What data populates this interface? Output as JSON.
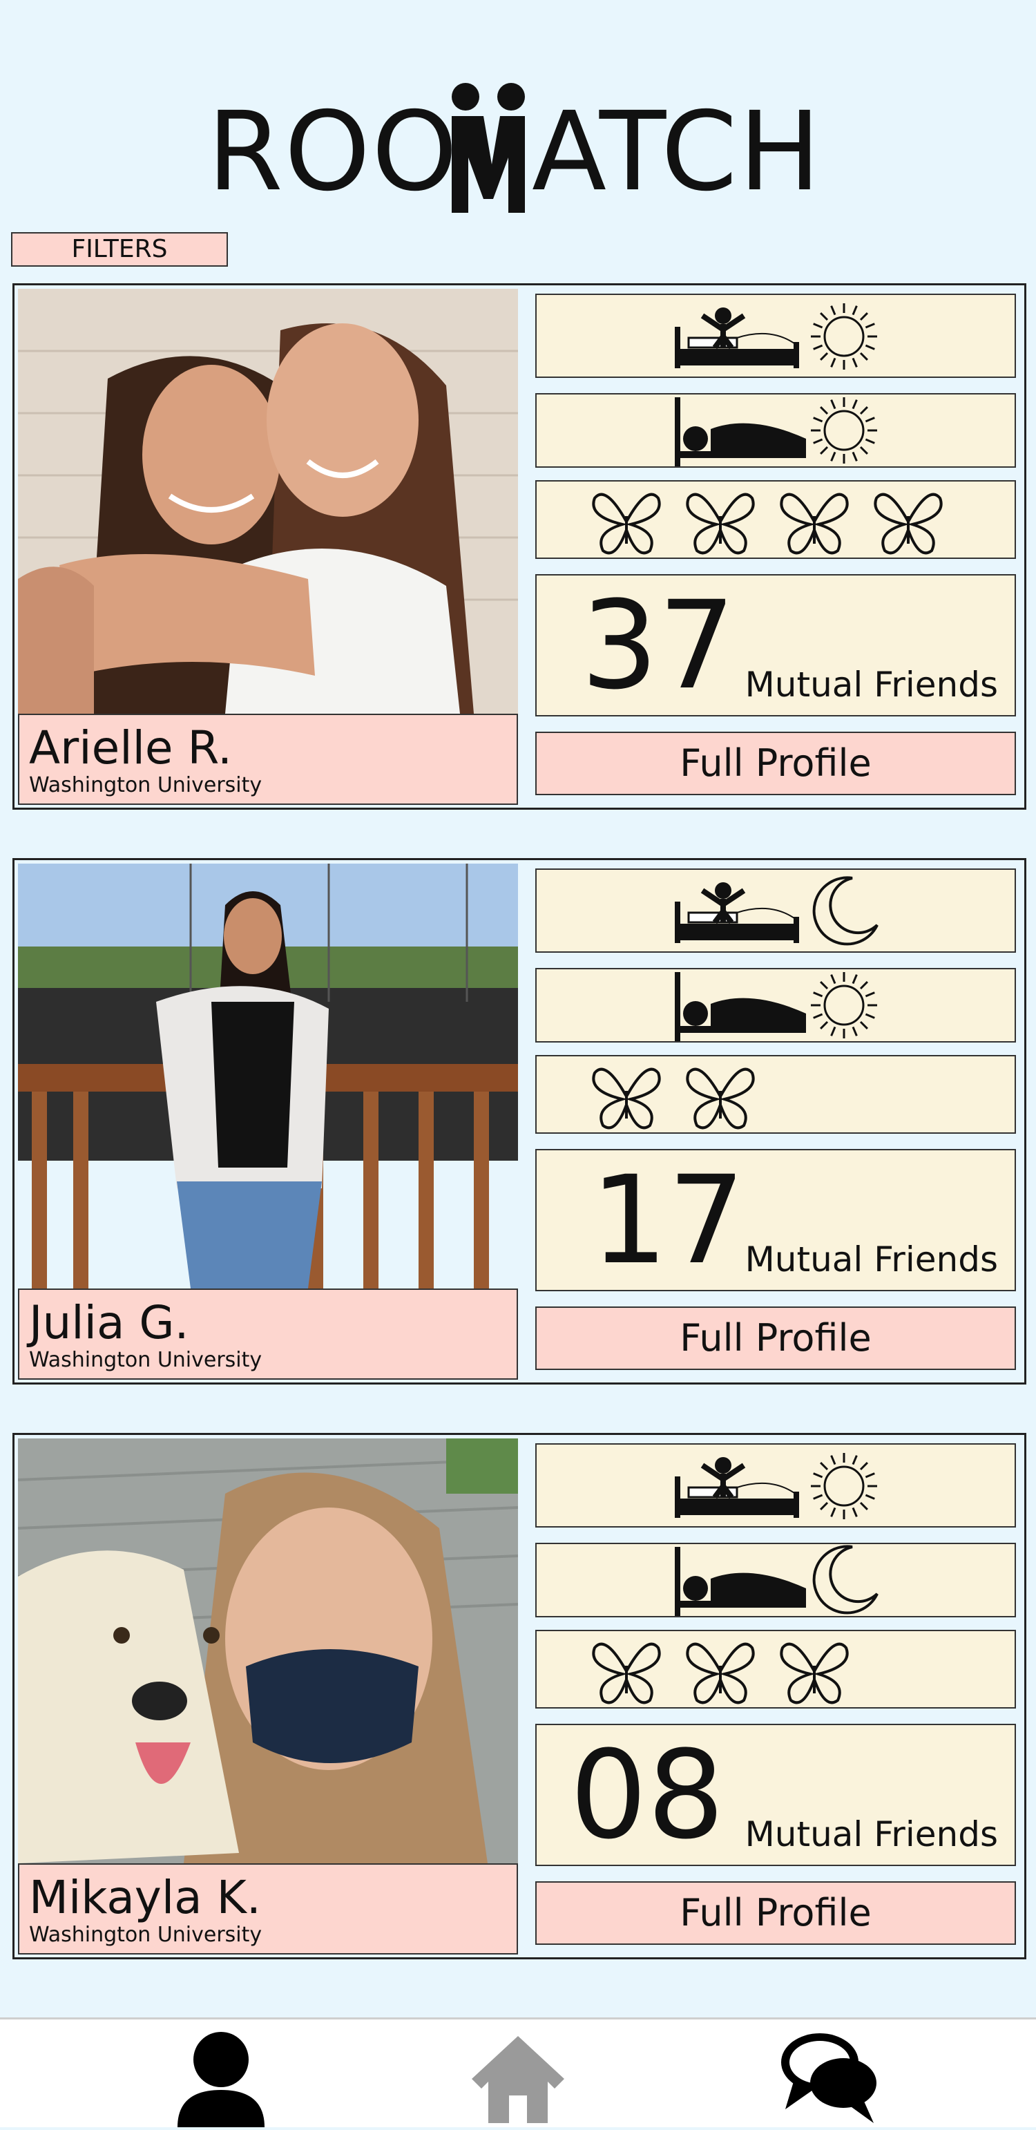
{
  "app": {
    "logo_text_left": "ROO",
    "logo_text_right": "ATCH"
  },
  "filters": {
    "label": "FILTERS"
  },
  "cards": [
    {
      "name": "Arielle R.",
      "school": "Washington University",
      "wake_icon": "sun-icon",
      "sleep_icon": "sun-icon",
      "social_level": 4,
      "mutual_count": "37",
      "mutual_label": "Mutual Friends",
      "profile_label": "Full Profile"
    },
    {
      "name": "Julia G.",
      "school": "Washington University",
      "wake_icon": "moon-icon",
      "sleep_icon": "sun-icon",
      "social_level": 2,
      "mutual_count": "17",
      "mutual_label": "Mutual Friends",
      "profile_label": "Full Profile"
    },
    {
      "name": "Mikayla K.",
      "school": "Washington University",
      "wake_icon": "sun-icon",
      "sleep_icon": "moon-icon",
      "social_level": 3,
      "mutual_count": "08",
      "mutual_label": "Mutual Friends",
      "profile_label": "Full Profile"
    }
  ],
  "nav": [
    {
      "icon": "person-icon",
      "active": true
    },
    {
      "icon": "home-icon",
      "active": false
    },
    {
      "icon": "chat-icon",
      "active": false
    }
  ],
  "colors": {
    "background": "#e8f6fd",
    "panel": "#faf3dc",
    "accent": "#fdd6cf",
    "inactive_nav": "#9a9a9a"
  }
}
